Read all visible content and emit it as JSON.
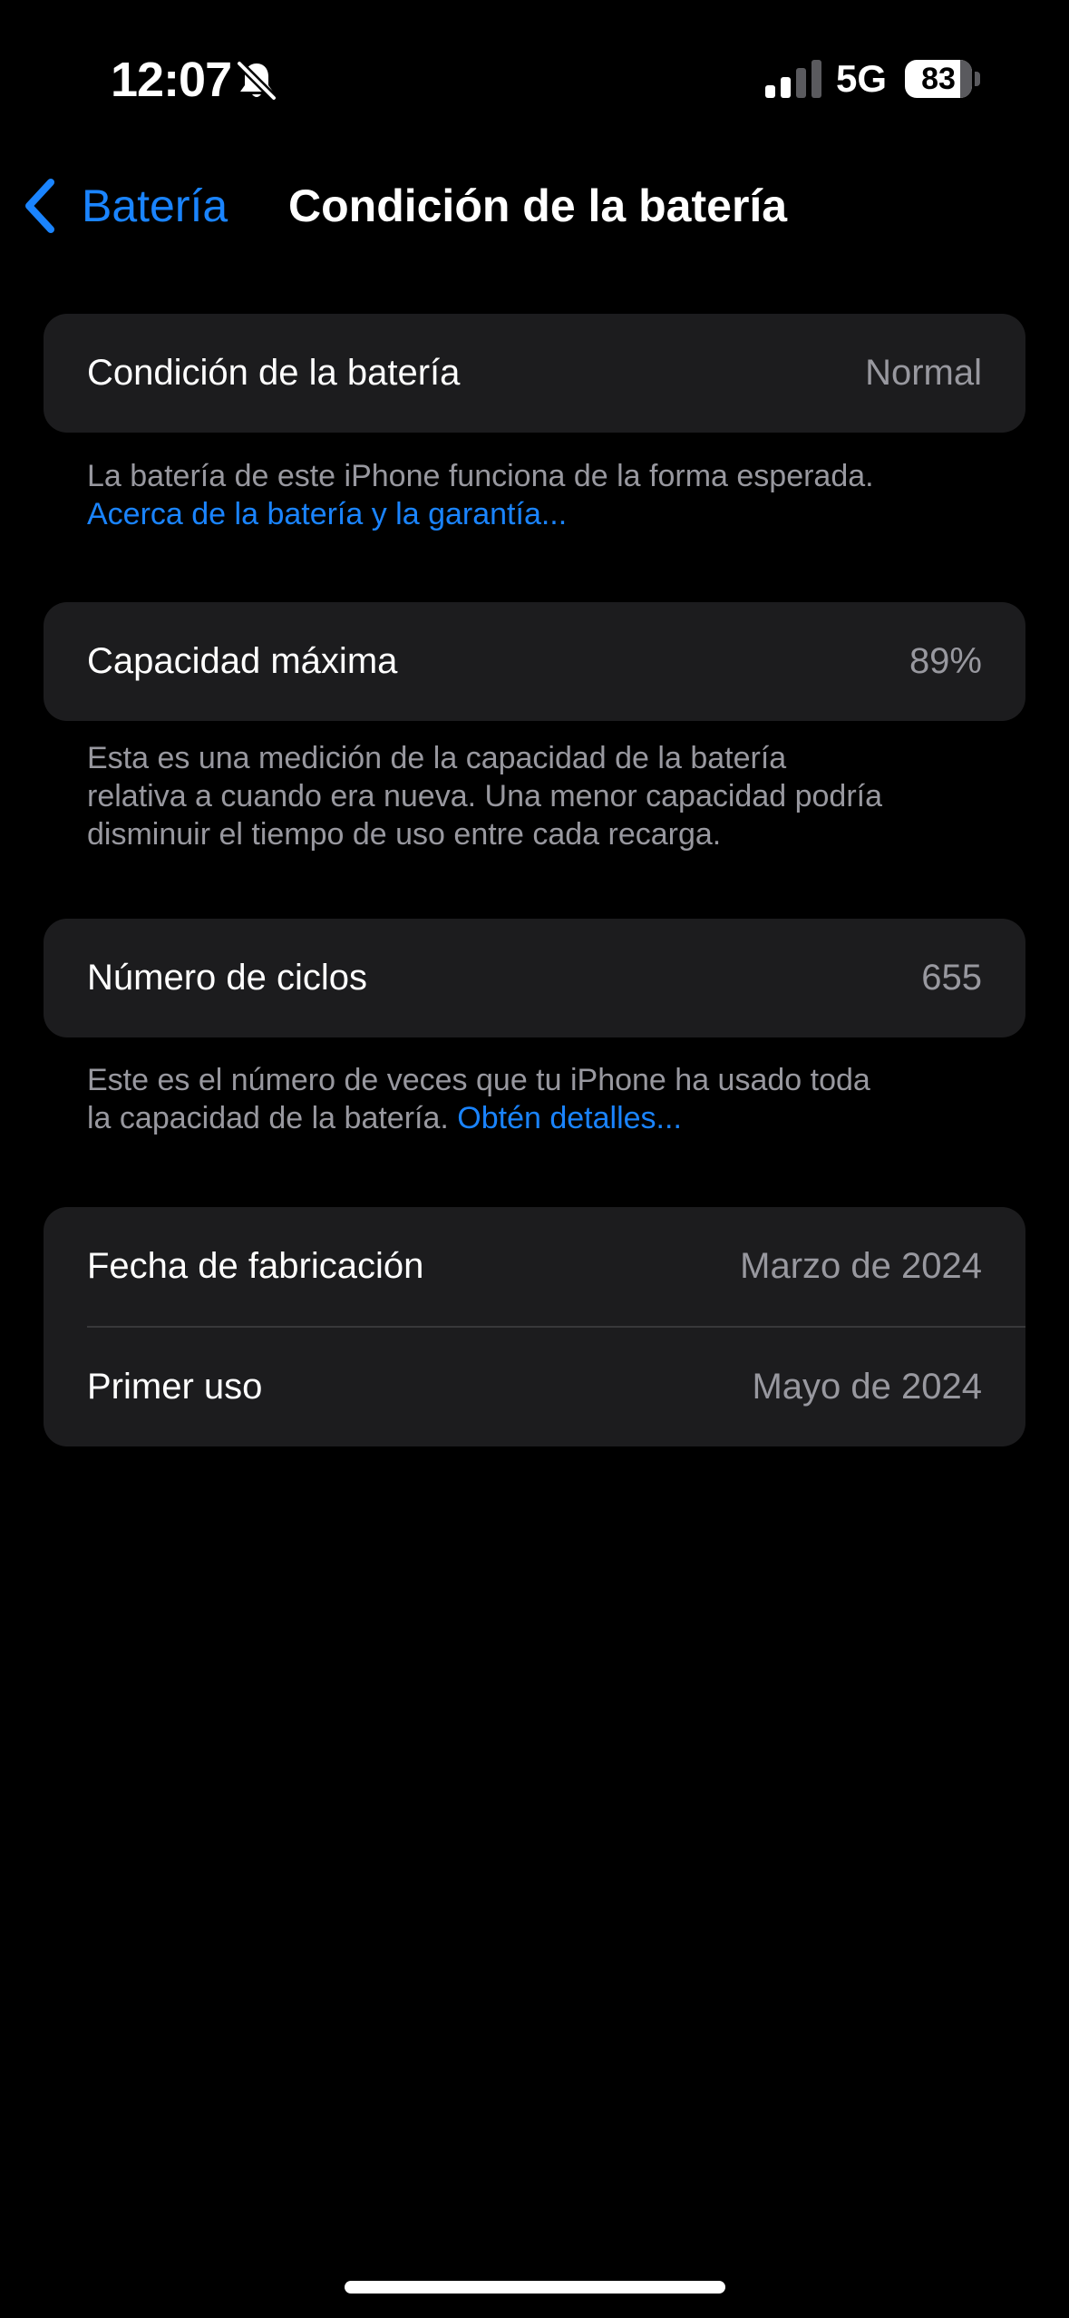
{
  "status_bar": {
    "time": "12:07",
    "network": "5G",
    "battery_level": "83",
    "battery_fraction": 0.83,
    "icons": [
      "bell-slash-icon",
      "cellular-signal-icon",
      "battery-icon"
    ]
  },
  "nav": {
    "back_label": "Batería",
    "title": "Condición de la batería",
    "back_icon": "chevron-left-icon"
  },
  "sections": {
    "condition": {
      "label": "Condición de la batería",
      "value": "Normal",
      "footer_text": "La batería de este iPhone funciona de la forma esperada.",
      "footer_link": "Acerca de la batería y la garantía..."
    },
    "capacity": {
      "label": "Capacidad máxima",
      "value": "89%",
      "footer_line1": "Esta es una medición de la capacidad de la batería",
      "footer_line2": "relativa a cuando era nueva. Una menor capacidad podría",
      "footer_line3": "disminuir el tiempo de uso entre cada recarga."
    },
    "cycles": {
      "label": "Número de ciclos",
      "value": "655",
      "footer_line1": "Este es el número de veces que tu iPhone ha usado toda",
      "footer_line2": "la capacidad de la batería.",
      "footer_link": "Obtén detalles..."
    },
    "dates": {
      "manufacture_label": "Fecha de fabricación",
      "manufacture_value": "Marzo de 2024",
      "first_use_label": "Primer uso",
      "first_use_value": "Mayo de 2024"
    }
  },
  "colors": {
    "background": "#000000",
    "cell_background": "#1c1c1e",
    "accent": "#1a84ff",
    "secondary_text": "#98989f",
    "separator": "#38383a"
  }
}
